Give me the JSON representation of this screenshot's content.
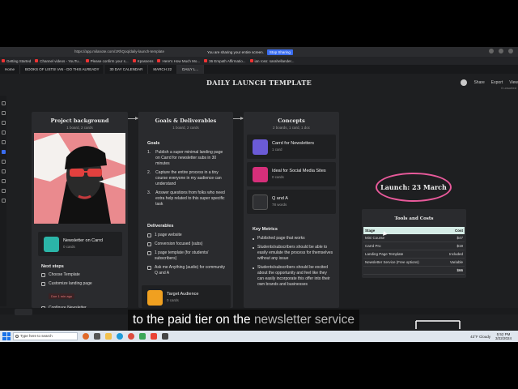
{
  "browser": {
    "url": "https://app.milanote.com/1RhQoq/daily-launch-template",
    "share_notice": "You are sharing your entire screen.",
    "stop_sharing": "Stop Sharing"
  },
  "bookmarks": [
    "Getting Started",
    "Channel videos - YouTu...",
    "Please confirm your s...",
    "Kpassens",
    "Here's How Much Mo...",
    "36 Empath Affirmatio...",
    "ian ross: sarahellander..."
  ],
  "tabs": [
    "Home",
    "BOOKS OF LISTS! IAN - DO THIS ALREADY",
    "30 DAY CALENDAR",
    "MARCH 22",
    "DAILY L..."
  ],
  "board": {
    "title": "DAILY LAUNCH TEMPLATE",
    "share": "Share",
    "export": "Export",
    "view": "View",
    "sub_right": "0 unsorted"
  },
  "columns": {
    "project": {
      "title": "Project background",
      "subtitle": "1 board, 2 cards",
      "newsletter_card": {
        "name": "Newsletter on Carrd",
        "meta": "0 cards"
      },
      "next_steps_title": "Next steps",
      "next_steps": [
        {
          "label": "Choose Template"
        },
        {
          "label": "Customize landing page"
        },
        {
          "label": "Configure Newsletter"
        }
      ],
      "due_badge": "Due 1 min ago"
    },
    "goals": {
      "title": "Goals & Deliverables",
      "subtitle": "1 board, 2 cards",
      "goals_title": "Goals",
      "goals": [
        "Publish a super minimal landing page on Carrd for newsletter subs in 30 minutes",
        "Capture the entire process in a tiny course everyone in my audience can understand",
        "Answer questions from folks who need extra help related to this super specific task"
      ],
      "deliverables_title": "Deliverables",
      "deliverables": [
        "1 page website",
        "Conversion focused (subs)",
        "1 page template (for students/ subscribers)",
        "Ask me Anything (audio) for community Q and A"
      ],
      "target_card": {
        "name": "Target Audience",
        "meta": "0 cards"
      }
    },
    "concepts": {
      "title": "Concepts",
      "subtitle": "2 boards, 1 card, 1 doc",
      "cards": [
        {
          "name": "Carrd for Newsletters",
          "meta": "1 card"
        },
        {
          "name": "Ideal for Social Media Sites",
          "meta": "0 cards"
        },
        {
          "name": "Q and A",
          "meta": "78 words"
        }
      ],
      "metrics_title": "Key Metrics",
      "metrics": [
        "Published page that works",
        "Students/subscribers should be able to easily emulate the process for themselves without any issue",
        "Students/subscribers should be excited about the opportunity and feel like they can easily incorporate this offer into their own brands and businesses"
      ]
    }
  },
  "launch_label": "Launch: 23 March",
  "costs": {
    "title": "Tools and Costs",
    "headers": [
      "Stage",
      "Cost"
    ],
    "rows": [
      [
        "Mini Course",
        "$47"
      ],
      [
        "Carrd Pro",
        "$19"
      ],
      [
        "Landing Page Template",
        "Included"
      ],
      [
        "Newsletter Service   (Free options)",
        "Variable"
      ]
    ],
    "total": "$66"
  },
  "caption": {
    "main": "to the paid tier on the ",
    "dim": "newsletter service"
  },
  "taskbar": {
    "search": "Type here to search",
    "weather": "43°F Cloudy",
    "time": "5:52 PM",
    "date": "3/22/2024"
  },
  "colors": {
    "accent_pink": "#e85a9b",
    "table_header": "#d5ece6",
    "carrd_icon": "#6b5bd6",
    "instagram_icon": "#d62f7a",
    "target_icon": "#f0a020",
    "newsletter_icon": "#2bb5a8"
  }
}
